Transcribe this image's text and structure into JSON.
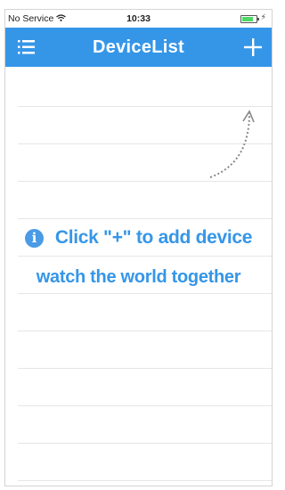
{
  "status_bar": {
    "carrier": "No Service",
    "wifi_icon": "wifi-icon",
    "time": "10:33",
    "battery_icon": "battery-icon",
    "charge_symbol": "⚡"
  },
  "nav_bar": {
    "title": "DeviceList",
    "menu_icon": "hamburger-menu-icon",
    "add_icon": "plus-icon",
    "color": "#3596e8"
  },
  "empty_state": {
    "info_icon": "i",
    "line1": "Click \"+\" to add device",
    "line2": "watch the world together",
    "color": "#3596e8",
    "arrow_icon": "dotted-curved-arrow-icon"
  }
}
